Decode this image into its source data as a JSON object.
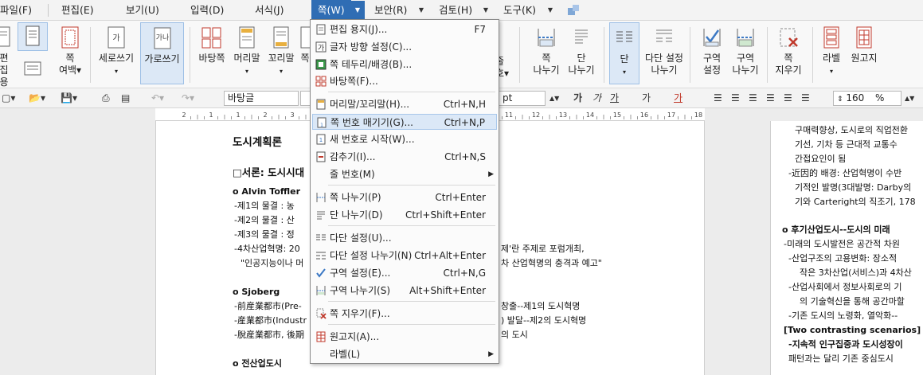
{
  "menubar": {
    "items": [
      {
        "label": "파일(F)",
        "active": false
      },
      {
        "label": "편집(E)",
        "active": false
      },
      {
        "label": "보기(U)",
        "active": false
      },
      {
        "label": "입력(D)",
        "active": false
      },
      {
        "label": "서식(J)",
        "active": false
      },
      {
        "label": "쪽(W)",
        "active": true
      },
      {
        "label": "보안(R)",
        "active": false
      },
      {
        "label": "검토(H)",
        "active": false
      },
      {
        "label": "도구(K)",
        "active": false
      }
    ]
  },
  "ribbon": {
    "buttons": [
      {
        "label1": "편집",
        "label2": "용지",
        "icon": "page-setup-icon"
      },
      {
        "label1": "쪽",
        "label2": "여백▾",
        "icon": "page-margin-icon"
      },
      {
        "label1": "세로쓰기",
        "label2": "",
        "icon": "vertical-writing-icon"
      },
      {
        "label1": "가로쓰기",
        "label2": "",
        "icon": "horizontal-writing-icon"
      },
      {
        "label1": "바탕쪽",
        "label2": "",
        "icon": "master-page-icon"
      },
      {
        "label1": "머리말",
        "label2": "",
        "icon": "header-icon"
      },
      {
        "label1": "꼬리말",
        "label2": "",
        "icon": "footer-icon"
      },
      {
        "label1": "쪽",
        "label2": "",
        "icon": "page-icon"
      },
      {
        "label1": "쪽",
        "label2": "나누기",
        "icon": "page-break-icon"
      },
      {
        "label1": "단",
        "label2": "나누기",
        "icon": "column-break-icon"
      },
      {
        "label1": "단",
        "label2": "",
        "icon": "columns-icon"
      },
      {
        "label1": "다단 설정",
        "label2": "나누기",
        "icon": "multi-column-break-icon"
      },
      {
        "label1": "구역",
        "label2": "설정",
        "icon": "section-setup-icon"
      },
      {
        "label1": "구역",
        "label2": "나누기",
        "icon": "section-break-icon"
      },
      {
        "label1": "쪽",
        "label2": "지우기",
        "icon": "page-delete-icon"
      },
      {
        "label1": "라벨",
        "label2": "",
        "icon": "label-icon"
      },
      {
        "label1": "원고지",
        "label2": "",
        "icon": "manuscript-icon"
      }
    ],
    "partial_labels": [
      "줄",
      "호▾"
    ]
  },
  "toolbar": {
    "font_name": "바탕글",
    "unit": "pt",
    "zoom": "160",
    "zoom_unit": "%",
    "style_buttons": [
      "가",
      "가",
      "가",
      "가",
      "가"
    ]
  },
  "dropdown": {
    "items": [
      {
        "label": "편집 용지(J)...",
        "shortcut": "F7",
        "icon": "page-setup-icon",
        "sub": false
      },
      {
        "label": "글자 방향 설정(C)...",
        "shortcut": "",
        "icon": "text-direction-icon",
        "sub": false
      },
      {
        "label": "쪽 테두리/배경(B)...",
        "shortcut": "",
        "icon": "page-border-icon",
        "sub": false
      },
      {
        "label": "바탕쪽(F)...",
        "shortcut": "",
        "icon": "master-page-icon",
        "sub": false
      },
      {
        "label": "머리말/꼬리말(H)...",
        "shortcut": "Ctrl+N,H",
        "icon": "header-footer-icon",
        "sub": false
      },
      {
        "label": "쪽 번호 매기기(G)...",
        "shortcut": "Ctrl+N,P",
        "icon": "page-number-icon",
        "sub": false,
        "highlight": true
      },
      {
        "label": "새 번호로 시작(W)...",
        "shortcut": "",
        "icon": "new-number-icon",
        "sub": false
      },
      {
        "label": "감추기(I)...",
        "shortcut": "Ctrl+N,S",
        "icon": "hide-icon",
        "sub": false
      },
      {
        "label": "줄 번호(M)",
        "shortcut": "",
        "icon": "",
        "sub": true
      },
      {
        "label": "쪽 나누기(P)",
        "shortcut": "Ctrl+Enter",
        "icon": "page-break-icon",
        "sub": false
      },
      {
        "label": "단 나누기(D)",
        "shortcut": "Ctrl+Shift+Enter",
        "icon": "column-break-icon",
        "sub": false
      },
      {
        "label": "다단 설정(U)...",
        "shortcut": "",
        "icon": "columns-icon",
        "sub": false
      },
      {
        "label": "다단 설정 나누기(N)",
        "shortcut": "Ctrl+Alt+Enter",
        "icon": "multi-column-break-icon",
        "sub": false
      },
      {
        "label": "구역 설정(E)...",
        "shortcut": "Ctrl+N,G",
        "icon": "section-setup-icon",
        "sub": false
      },
      {
        "label": "구역 나누기(S)",
        "shortcut": "Alt+Shift+Enter",
        "icon": "section-break-icon",
        "sub": false
      },
      {
        "label": "쪽 지우기(F)...",
        "shortcut": "",
        "icon": "page-delete-icon",
        "sub": false
      },
      {
        "label": "원고지(A)...",
        "shortcut": "",
        "icon": "manuscript-icon",
        "sub": false
      },
      {
        "label": "라벨(L)",
        "shortcut": "",
        "icon": "",
        "sub": true
      }
    ]
  },
  "document": {
    "page1_lines": [
      "도시계획론",
      "□서론: 도시시대",
      "o Alvin Toffler",
      "-제1의 물결 : 농",
      "-제2의 물결 : 산",
      "-제3의 물결 : 정",
      "-4차산업혁명: 20",
      "\"인공지능이나 머",
      "o Sjoberg",
      "-前産業都市(Pre-",
      "-産業都市(Industr",
      "-脫産業都市, 後期",
      "o 전산업도시"
    ],
    "page1_right_lines": [
      "제'란 주제로 포럼개최,",
      "차 산업혁명의 충격과 예고\"",
      "창출--제1의 도시혁명",
      ") 발달--제2의 도시혁명",
      "의 도시"
    ],
    "page2_lines": [
      "구매력향상, 도시로의 직업전환",
      "기선, 기차 등 근대적 교통수",
      "간접요인이 됨",
      "-近因的 배경: 산업혁명이 수반",
      "기적인 발명(3대발명: Darby의",
      "기와 Carteright의 직조기, 178",
      "o 후기산업도시--도시의 미래",
      "-미래의 도시발전은 공간적 차원",
      "-산업구조의 고용변화: 장소적",
      "작은 3차산업(서비스)과 4차산",
      "-산업사회에서 정보사회로의 기",
      "의 기술혁신을 통해 공간마할",
      "-기존 도시의 노령화, 열악화--",
      "[Two contrasting scenarios]",
      "-지속적 인구집중과 도시성장이",
      "패턴과는 달리 기존 중심도시"
    ],
    "ruler_ticks": [
      "2",
      "1",
      "1",
      "2",
      "3",
      "4",
      "5",
      "6",
      "7",
      "8",
      "9",
      "10",
      "11",
      "12",
      "13",
      "14",
      "15",
      "16",
      "17",
      "18"
    ]
  },
  "colors": {
    "accent": "#2f6db4",
    "highlight": "#dbe8f7",
    "red_icon": "#c0392b"
  }
}
